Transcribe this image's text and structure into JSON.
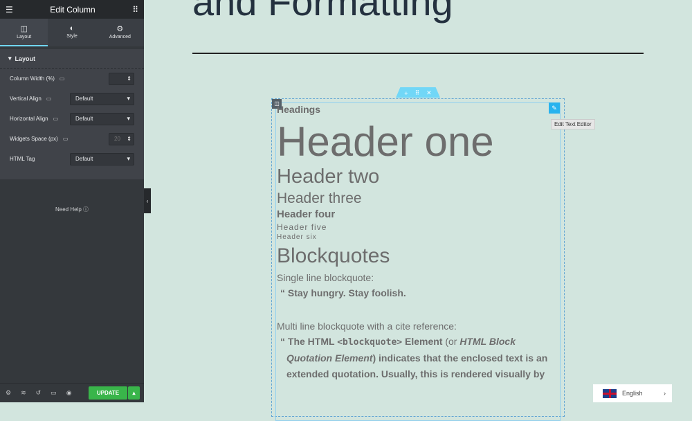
{
  "sidebar": {
    "title": "Edit Column",
    "tabs": [
      {
        "label": "Layout",
        "icon": "columns-icon"
      },
      {
        "label": "Style",
        "icon": "half-circle-icon"
      },
      {
        "label": "Advanced",
        "icon": "gear-icon"
      }
    ],
    "section": "Layout",
    "fields": [
      {
        "label": "Column Width (%)",
        "value": ""
      },
      {
        "label": "Vertical Align",
        "value": "Default"
      },
      {
        "label": "Horizontal Align",
        "value": "Default"
      },
      {
        "label": "Widgets Space (px)",
        "placeholder": "20"
      },
      {
        "label": "HTML Tag",
        "value": "Default"
      }
    ],
    "help": "Need Help",
    "update": "UPDATE"
  },
  "canvas": {
    "title": "and Formatting",
    "tooltip": "Edit Text Editor",
    "content": {
      "headings": "Headings",
      "h1": "Header one",
      "h2": "Header two",
      "h3": "Header three",
      "h4": "Header four",
      "h5": "Header five",
      "h6": "Header six",
      "blockquotes": "Blockquotes",
      "single_label": "Single line blockquote:",
      "single_quote": "Stay hungry. Stay foolish.",
      "multi_label": "Multi line blockquote with a cite reference:",
      "multi": {
        "p1": "The ",
        "p2": "HTML ",
        "p3": "<blockquote>",
        "p4": " Element",
        " p5": "",
        "p6": " (or ",
        "p7": "HTML Block Quotation Element",
        "p8": ") indicates that the enclosed text is an extended quotation. Usually, this is rendered visually by"
      }
    }
  },
  "language": "English",
  "colors": {
    "accent": "#71d7f7",
    "update": "#39b54a",
    "canvas": "#d2e5de"
  }
}
